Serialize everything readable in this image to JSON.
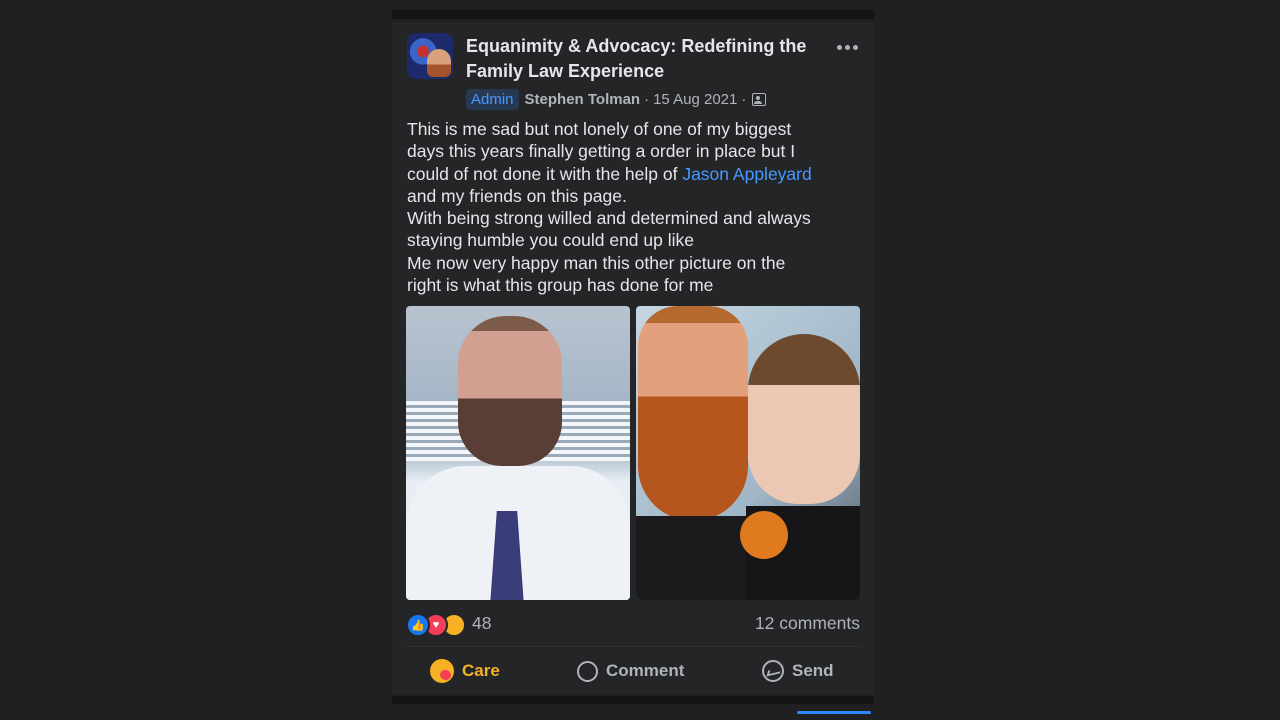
{
  "post": {
    "group_name": "Equanimity & Advocacy: Redefining the Family Law Experience",
    "admin_badge": "Admin",
    "author": "Stephen Tolman",
    "separator": "·",
    "date": "15 Aug 2021",
    "privacy_icon": "group-members-icon",
    "text_lines": [
      "This is me sad but not lonely of one of my biggest",
      "days this years finally getting a order in place but I",
      "could of not done it with the help of ",
      "and my friends on this page.",
      "With being strong willed and determined and always",
      "staying humble you could end up like",
      "Me now very happy man this other picture on the",
      "right is what this group has done for me"
    ],
    "mention": "Jason Appleyard",
    "photos": [
      {
        "subject": "man in white shirt and navy tie"
      },
      {
        "subject": "man with red beard and child holding a toy"
      }
    ]
  },
  "engagement": {
    "reaction_icons": [
      "like-icon",
      "love-icon",
      "care-icon"
    ],
    "reaction_count": "48",
    "comments": "12 comments"
  },
  "actions": {
    "care_label": "Care",
    "comment_label": "Comment",
    "send_label": "Send"
  },
  "colors": {
    "background": "#202023",
    "card": "#242526",
    "link": "#4599ff",
    "care": "#f7b125",
    "muted_text": "#b0b3b8"
  }
}
